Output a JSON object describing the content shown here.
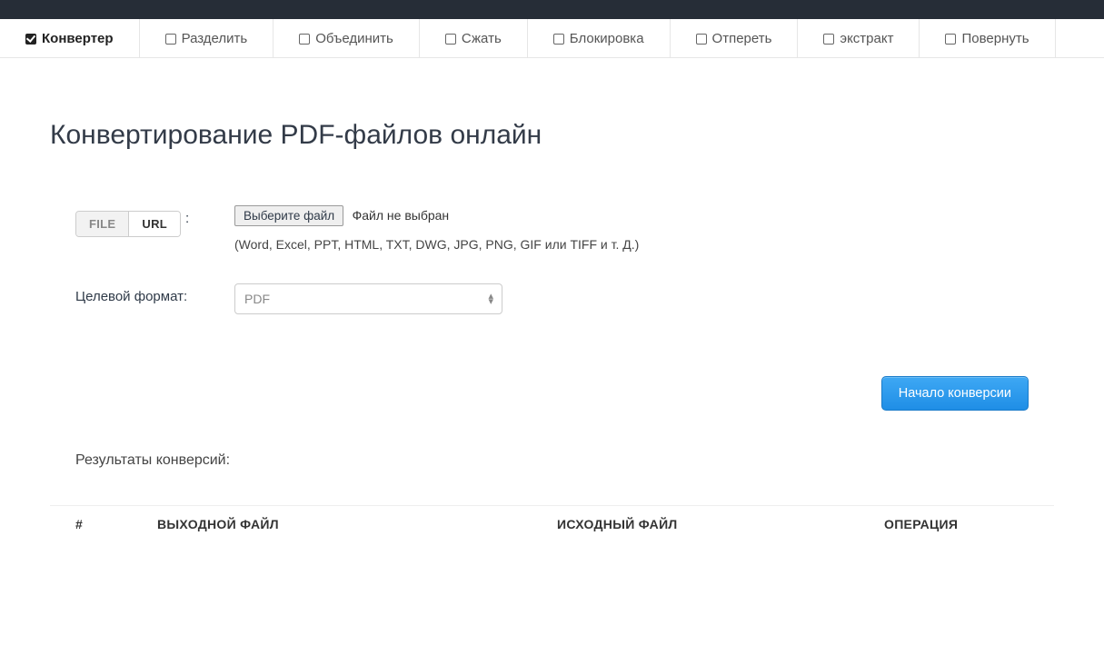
{
  "tabs": [
    {
      "label": "Конвертер",
      "active": true
    },
    {
      "label": "Разделить",
      "active": false
    },
    {
      "label": "Объединить",
      "active": false
    },
    {
      "label": "Сжать",
      "active": false
    },
    {
      "label": "Блокировка",
      "active": false
    },
    {
      "label": "Отпереть",
      "active": false
    },
    {
      "label": "экстракт",
      "active": false
    },
    {
      "label": "Повернуть",
      "active": false
    }
  ],
  "heading": "Конвертирование PDF-файлов онлайн",
  "source": {
    "seg_file": "FILE",
    "seg_url": "URL",
    "colon": ":",
    "choose_btn": "Выберите файл",
    "no_file": "Файл не выбран",
    "hint": "(Word, Excel, PPT, HTML, TXT, DWG, JPG, PNG, GIF или TIFF и т. Д.)"
  },
  "target": {
    "label": "Целевой формат:",
    "value": "PDF"
  },
  "actions": {
    "start": "Начало конверсии"
  },
  "results": {
    "title": "Результаты конверсий:",
    "cols": {
      "idx": "#",
      "out": "ВЫХОДНОЙ ФАЙЛ",
      "src": "ИСХОДНЫЙ ФАЙЛ",
      "op": "ОПЕРАЦИЯ"
    }
  }
}
